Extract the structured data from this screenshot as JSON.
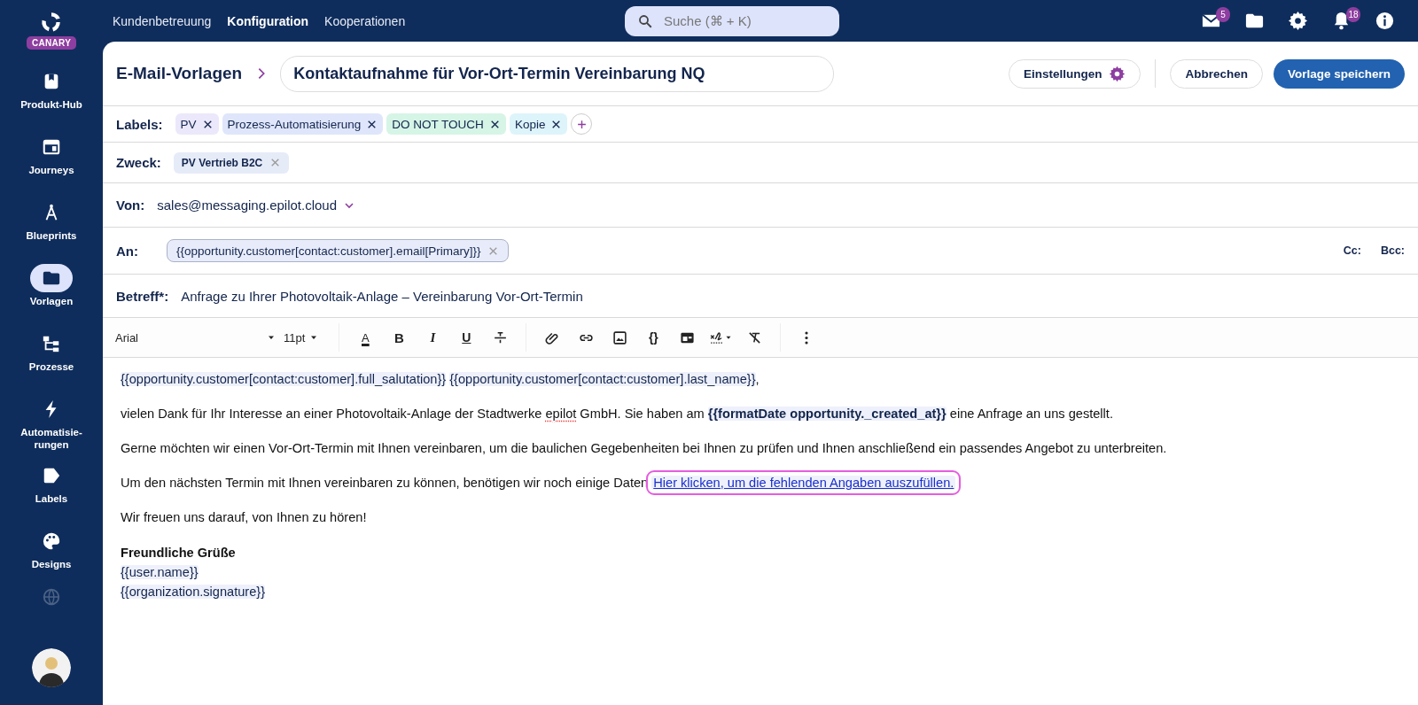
{
  "sidebar": {
    "logo": {
      "badge": "CANARY"
    },
    "items": [
      {
        "label": "Produkt-Hub",
        "selected": false
      },
      {
        "label": "Journeys",
        "selected": false
      },
      {
        "label": "Blueprints",
        "selected": false
      },
      {
        "label": "Vorlagen",
        "selected": true
      },
      {
        "label": "Prozesse",
        "selected": false
      },
      {
        "label": "Automatisie-\nrungen",
        "selected": false
      },
      {
        "label": "Labels",
        "selected": false
      },
      {
        "label": "Designs",
        "selected": false
      }
    ]
  },
  "top_nav": {
    "links": [
      {
        "label": "Kundenbetreuung",
        "selected": false
      },
      {
        "label": "Konfiguration",
        "selected": true
      },
      {
        "label": "Kooperationen",
        "selected": false
      }
    ],
    "search": {
      "placeholder": "Suche (⌘ + K)"
    },
    "mail_badge": "5",
    "bell_badge": "18"
  },
  "header": {
    "breadcrumb": "E-Mail-Vorlagen",
    "title": "Kontaktaufnahme für Vor-Ort-Termin Vereinbarung NQ",
    "buttons": [
      {
        "label": "Einstellungen",
        "kind": "settings"
      },
      {
        "label": "Abbrechen",
        "kind": "secondary"
      },
      {
        "label": "Vorlage speichern",
        "kind": "primary"
      }
    ]
  },
  "labels": {
    "caption": "Labels:",
    "items": [
      {
        "text": "PV",
        "color": "#ece8fb"
      },
      {
        "text": "Prozess-Automatisierung",
        "color": "#dfe6fb"
      },
      {
        "text": "DO NOT TOUCH",
        "color": "#d6f5e6"
      },
      {
        "text": "Kopie",
        "color": "#def4fb"
      }
    ]
  },
  "purpose": {
    "caption": "Zweck:",
    "chips": [
      "PV Vertrieb B2C"
    ]
  },
  "from": {
    "caption": "Von:",
    "value": "sales@messaging.epilot.cloud"
  },
  "to": {
    "caption": "An:",
    "chips": [
      "{{opportunity.customer[contact:customer].email[Primary]}}"
    ],
    "cc": "Cc:",
    "bcc": "Bcc:"
  },
  "subject": {
    "caption": "Betreff*:",
    "value": "Anfrage zu Ihrer Photovoltaik-Anlage – Vereinbarung Vor-Ort-Termin"
  },
  "toolbar": [
    {
      "kind": "select",
      "label": "Arial"
    },
    {
      "kind": "select",
      "label": "11pt"
    },
    {
      "kind": "divider"
    },
    {
      "kind": "textcolor",
      "glyph": "A"
    },
    {
      "kind": "bold",
      "glyph": "B"
    },
    {
      "kind": "italic",
      "glyph": "I"
    },
    {
      "kind": "underline",
      "glyph": "U"
    },
    {
      "kind": "strike"
    },
    {
      "kind": "divider"
    },
    {
      "kind": "attach"
    },
    {
      "kind": "link"
    },
    {
      "kind": "image"
    },
    {
      "kind": "code",
      "glyph": "{}"
    },
    {
      "kind": "table"
    },
    {
      "kind": "signature"
    },
    {
      "kind": "clear"
    },
    {
      "kind": "divider"
    },
    {
      "kind": "more"
    }
  ],
  "body": {
    "paragraphs": [
      {
        "segments": [
          {
            "kind": "variable",
            "text": "{{opportunity.customer[contact:customer].full_salutation}}"
          },
          {
            "kind": "variable",
            "text": "{{opportunity.customer[contact:customer].last_name}}"
          },
          {
            "kind": "text",
            "text": ","
          }
        ]
      },
      {
        "segments": [
          {
            "kind": "text",
            "text": "vielen Dank für Ihr Interesse an einer Photovoltaik-Anlage der Stadtwerke "
          },
          {
            "kind": "misspelled",
            "text": "epilot"
          },
          {
            "kind": "text",
            "text": " GmbH. Sie haben am "
          },
          {
            "kind": "variable",
            "bold": true,
            "text": "{{formatDate opportunity._created_at}}"
          },
          {
            "kind": "text",
            "text": " eine Anfrage an uns gestellt."
          }
        ]
      },
      {
        "segments": [
          {
            "kind": "text",
            "text": "Gerne möchten wir einen Vor-Ort-Termin mit Ihnen vereinbaren, um die baulichen Gegebenheiten bei Ihnen zu prüfen und Ihnen anschließend ein passendes Angebot zu unterbreiten."
          }
        ]
      },
      {
        "segments": [
          {
            "kind": "text",
            "text": "Um den nächsten Termin mit Ihnen vereinbaren zu können, benötigen wir noch einige Daten "
          },
          {
            "kind": "link",
            "highlighted": true,
            "text": "Hier klicken, um die fehlenden Angaben auszufüllen."
          }
        ]
      },
      {
        "segments": [
          {
            "kind": "text",
            "text": "Wir freuen uns darauf, von Ihnen zu hören!"
          }
        ]
      }
    ],
    "signature": [
      {
        "kind": "closing",
        "text": "Freundliche Grüße"
      },
      {
        "kind": "variable",
        "text": "{{user.name}}"
      },
      {
        "kind": "variable",
        "text": "{{organization.signature}}"
      }
    ]
  }
}
